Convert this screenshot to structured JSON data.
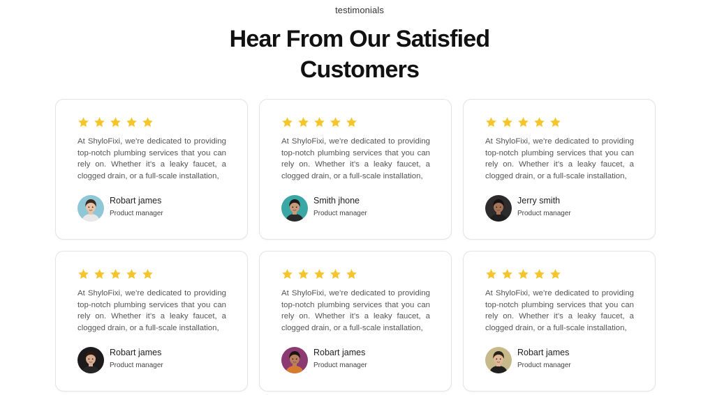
{
  "section": {
    "eyebrow": "testimonials",
    "title": "Hear From Our Satisfied Customers"
  },
  "colors": {
    "star": "#F6C52B",
    "card_border": "#E4E4E4",
    "text": "#555555"
  },
  "testimonials": [
    {
      "rating": 5,
      "text": "At ShyloFixi, we’re dedicated to providing top-notch plumbing services that you can rely on. Whether it’s a leaky faucet, a clogged drain, or a full-scale installation,",
      "name": "Robart james",
      "role": "Product manager",
      "avatar": {
        "bg": "#8fc7d6",
        "skin": "#e9c3a6",
        "hair": "#3b2a22",
        "shirt": "#e8e8e8"
      }
    },
    {
      "rating": 5,
      "text": "At ShyloFixi, we’re dedicated to providing top-notch plumbing services that you can rely on. Whether it’s a leaky faucet, a clogged drain, or a full-scale installation,",
      "name": "Smith jhone",
      "role": "Product manager",
      "avatar": {
        "bg": "#3aa7a6",
        "skin": "#c99b7a",
        "hair": "#1d1b1b",
        "shirt": "#2a2a2a"
      }
    },
    {
      "rating": 5,
      "text": "At ShyloFixi, we’re dedicated to providing top-notch plumbing services that you can rely on. Whether it’s a leaky faucet, a clogged drain, or a full-scale installation,",
      "name": "Jerry smith",
      "role": "Product manager",
      "avatar": {
        "bg": "#2e2b2c",
        "skin": "#a77358",
        "hair": "#161212",
        "shirt": "#1e1e1e"
      }
    },
    {
      "rating": 5,
      "text": "At ShyloFixi, we’re dedicated to providing top-notch plumbing services that you can rely on. Whether it’s a leaky faucet, a clogged drain, or a full-scale installation,",
      "name": "Robart james",
      "role": "Product manager",
      "avatar": {
        "bg": "#1c1a1a",
        "skin": "#d8ad92",
        "hair": "#2a1b14",
        "shirt": "#262626"
      }
    },
    {
      "rating": 5,
      "text": "At ShyloFixi, we’re dedicated to providing top-notch plumbing services that you can rely on. Whether it’s a leaky faucet, a clogged drain, or a full-scale installation,",
      "name": "Robart james",
      "role": "Product manager",
      "avatar": {
        "bg": "#8b3a72",
        "skin": "#b9805e",
        "hair": "#1b1410",
        "shirt": "#d77b2e"
      }
    },
    {
      "rating": 5,
      "text": "At ShyloFixi, we’re dedicated to providing top-notch plumbing services that you can rely on. Whether it’s a leaky faucet, a clogged drain, or a full-scale installation,",
      "name": "Robart james",
      "role": "Product manager",
      "avatar": {
        "bg": "#c8b98a",
        "skin": "#e2b997",
        "hair": "#2b211b",
        "shirt": "#1f1f1f"
      }
    }
  ]
}
